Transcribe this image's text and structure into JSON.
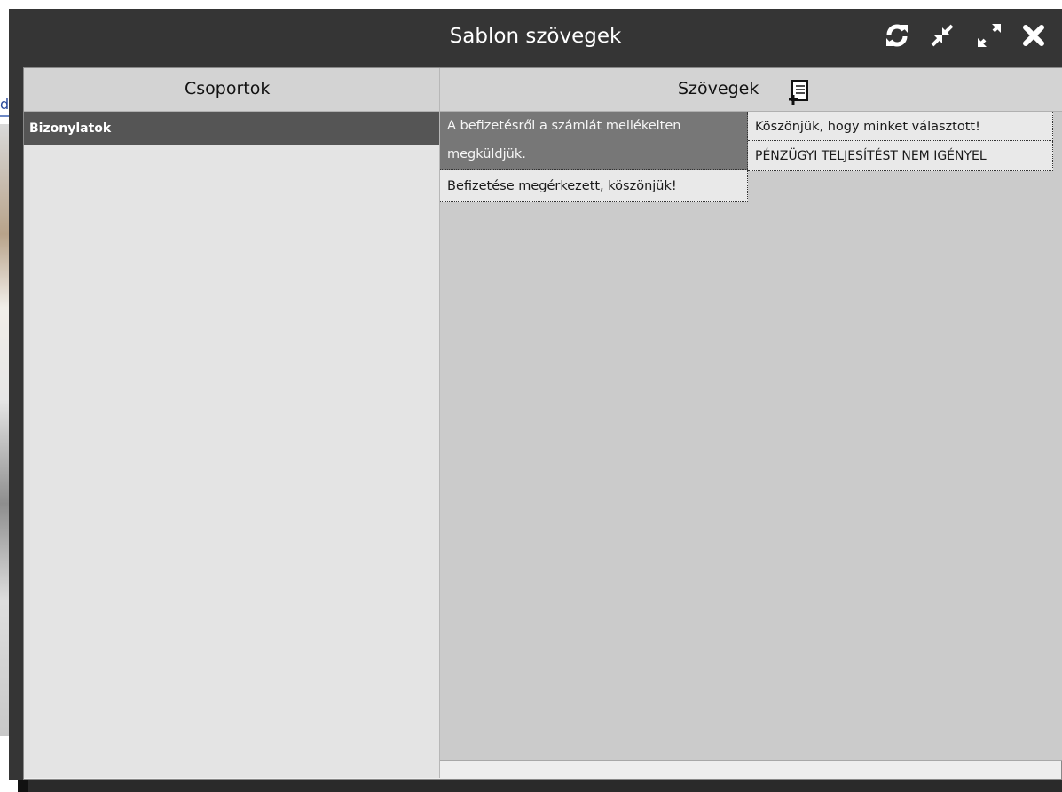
{
  "window": {
    "title": "Sablon szövegek",
    "buttons": [
      "refresh-icon",
      "minimize-arrows-icon",
      "expand-arrows-icon",
      "close-icon"
    ]
  },
  "background": {
    "partial_text": "dő"
  },
  "groups_panel": {
    "header": "Csoportok",
    "items": [
      {
        "label": "Bizonylatok",
        "selected": true
      }
    ]
  },
  "texts_panel": {
    "header": "Szövegek",
    "add_icon": "add-document-icon",
    "items": [
      {
        "text": "A befizetésről a számlát mellékelten megküldjük.",
        "selected": true
      },
      {
        "text": "Befizetése megérkezett, köszönjük!",
        "selected": false
      },
      {
        "text": "Köszönjük, hogy minket választott!",
        "selected": false
      },
      {
        "text": "PÉNZÜGYI TELJESÍTÉST NEM IGÉNYEL",
        "selected": false
      }
    ]
  },
  "colors": {
    "titlebar": "#353535",
    "selected_row": "#555555",
    "selected_text": "#777777",
    "right_panel": "#cbcbcb"
  }
}
